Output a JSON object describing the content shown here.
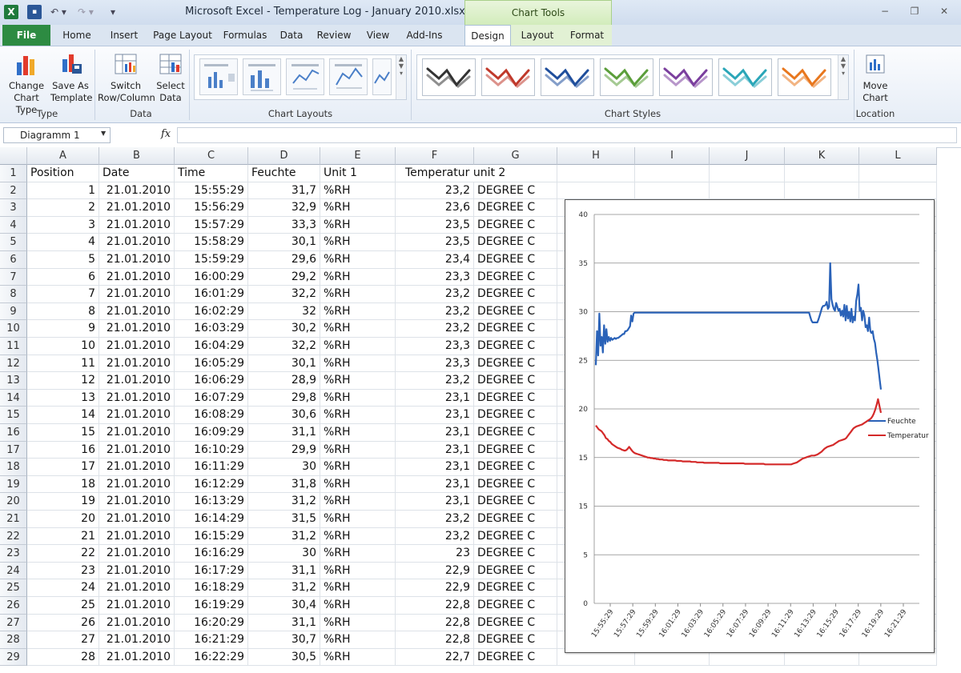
{
  "window": {
    "title": "Microsoft Excel - Temperature Log - January 2010.xlsx",
    "chart_tools_label": "Chart Tools",
    "controls": {
      "minimize": "−",
      "restore": "❐",
      "close": "✕"
    }
  },
  "quick_access": {
    "logo": "X",
    "save": "▪",
    "undo": "↶ ▾",
    "redo": "↷ ▾",
    "customize": "▾"
  },
  "tabs": [
    "File",
    "Home",
    "Insert",
    "Page Layout",
    "Formulas",
    "Data",
    "Review",
    "View",
    "Add-Ins",
    "Design",
    "Layout",
    "Format"
  ],
  "active_tab": "Design",
  "ribbon": {
    "type_group": {
      "label": "Type",
      "change_chart_type": [
        "Change",
        "Chart Type"
      ],
      "save_as_template": [
        "Save As",
        "Template"
      ]
    },
    "data_group": {
      "label": "Data",
      "switch_row_column": [
        "Switch",
        "Row/Column"
      ],
      "select_data": [
        "Select",
        "Data"
      ]
    },
    "chart_layouts_label": "Chart Layouts",
    "chart_styles_label": "Chart Styles",
    "style_colors": [
      "#333333",
      "#c0392b",
      "#1f4e9c",
      "#5b9e3a",
      "#7b3f9e",
      "#2aa6b8",
      "#e8771e"
    ],
    "location_group": {
      "label": "Location",
      "move_chart": [
        "Move",
        "Chart"
      ]
    }
  },
  "name_box": "Diagramm 1",
  "fx_label": "fx",
  "columns": [
    "A",
    "B",
    "C",
    "D",
    "E",
    "F",
    "G",
    "H",
    "I",
    "J",
    "K",
    "L"
  ],
  "header_row": [
    "Position",
    "Date",
    "Time",
    "Feuchte",
    "Unit 1",
    "Temperatur unit 2",
    ""
  ],
  "rows": [
    [
      "1",
      "21.01.2010",
      "15:55:29",
      "31,7",
      "%RH",
      "23,2",
      "DEGREE C"
    ],
    [
      "2",
      "21.01.2010",
      "15:56:29",
      "32,9",
      "%RH",
      "23,6",
      "DEGREE C"
    ],
    [
      "3",
      "21.01.2010",
      "15:57:29",
      "33,3",
      "%RH",
      "23,5",
      "DEGREE C"
    ],
    [
      "4",
      "21.01.2010",
      "15:58:29",
      "30,1",
      "%RH",
      "23,5",
      "DEGREE C"
    ],
    [
      "5",
      "21.01.2010",
      "15:59:29",
      "29,6",
      "%RH",
      "23,4",
      "DEGREE C"
    ],
    [
      "6",
      "21.01.2010",
      "16:00:29",
      "29,2",
      "%RH",
      "23,3",
      "DEGREE C"
    ],
    [
      "7",
      "21.01.2010",
      "16:01:29",
      "32,2",
      "%RH",
      "23,2",
      "DEGREE C"
    ],
    [
      "8",
      "21.01.2010",
      "16:02:29",
      "32",
      "%RH",
      "23,2",
      "DEGREE C"
    ],
    [
      "9",
      "21.01.2010",
      "16:03:29",
      "30,2",
      "%RH",
      "23,2",
      "DEGREE C"
    ],
    [
      "10",
      "21.01.2010",
      "16:04:29",
      "32,2",
      "%RH",
      "23,3",
      "DEGREE C"
    ],
    [
      "11",
      "21.01.2010",
      "16:05:29",
      "30,1",
      "%RH",
      "23,3",
      "DEGREE C"
    ],
    [
      "12",
      "21.01.2010",
      "16:06:29",
      "28,9",
      "%RH",
      "23,2",
      "DEGREE C"
    ],
    [
      "13",
      "21.01.2010",
      "16:07:29",
      "29,8",
      "%RH",
      "23,1",
      "DEGREE C"
    ],
    [
      "14",
      "21.01.2010",
      "16:08:29",
      "30,6",
      "%RH",
      "23,1",
      "DEGREE C"
    ],
    [
      "15",
      "21.01.2010",
      "16:09:29",
      "31,1",
      "%RH",
      "23,1",
      "DEGREE C"
    ],
    [
      "16",
      "21.01.2010",
      "16:10:29",
      "29,9",
      "%RH",
      "23,1",
      "DEGREE C"
    ],
    [
      "17",
      "21.01.2010",
      "16:11:29",
      "30",
      "%RH",
      "23,1",
      "DEGREE C"
    ],
    [
      "18",
      "21.01.2010",
      "16:12:29",
      "31,8",
      "%RH",
      "23,1",
      "DEGREE C"
    ],
    [
      "19",
      "21.01.2010",
      "16:13:29",
      "31,2",
      "%RH",
      "23,1",
      "DEGREE C"
    ],
    [
      "20",
      "21.01.2010",
      "16:14:29",
      "31,5",
      "%RH",
      "23,2",
      "DEGREE C"
    ],
    [
      "21",
      "21.01.2010",
      "16:15:29",
      "31,2",
      "%RH",
      "23,2",
      "DEGREE C"
    ],
    [
      "22",
      "21.01.2010",
      "16:16:29",
      "30",
      "%RH",
      "23",
      "DEGREE C"
    ],
    [
      "23",
      "21.01.2010",
      "16:17:29",
      "31,1",
      "%RH",
      "22,9",
      "DEGREE C"
    ],
    [
      "24",
      "21.01.2010",
      "16:18:29",
      "31,2",
      "%RH",
      "22,9",
      "DEGREE C"
    ],
    [
      "25",
      "21.01.2010",
      "16:19:29",
      "30,4",
      "%RH",
      "22,8",
      "DEGREE C"
    ],
    [
      "26",
      "21.01.2010",
      "16:20:29",
      "31,1",
      "%RH",
      "22,8",
      "DEGREE C"
    ],
    [
      "27",
      "21.01.2010",
      "16:21:29",
      "30,7",
      "%RH",
      "22,8",
      "DEGREE C"
    ],
    [
      "28",
      "21.01.2010",
      "16:22:29",
      "30,5",
      "%RH",
      "22,7",
      "DEGREE C"
    ]
  ],
  "chart_data": {
    "type": "line",
    "title": "",
    "xlabel": "",
    "ylabel": "",
    "ylim": [
      0,
      40
    ],
    "yticks": [
      "0",
      "5",
      "15",
      "15",
      "20",
      "25",
      "30",
      "35",
      "40"
    ],
    "categories": [
      "15:55:29",
      "15:57:29",
      "15:59:29",
      "16:01:29",
      "16:03:29",
      "16:05:29",
      "16:07:29",
      "16:09:29",
      "16:11:29",
      "16:13:29",
      "16:15:29",
      "16:17:29",
      "16:19:29",
      "16:21:29"
    ],
    "grid": true,
    "legend": "right",
    "series": [
      {
        "name": "Feuchte",
        "color": "#2a62b8",
        "values": [
          24.5,
          28.0,
          25.5,
          29.8,
          26.5,
          27.4,
          25.8,
          28.6,
          26.7,
          28.2,
          26.9,
          27.4,
          27.0,
          27.3,
          27.1,
          27.2,
          27.3,
          27.2,
          27.3,
          27.3,
          27.4,
          27.5,
          27.6,
          27.7,
          27.7,
          28.0,
          28.0,
          28.1,
          28.3,
          28.5,
          29.6,
          29.0,
          29.8,
          29.9,
          29.9,
          29.9,
          29.9,
          29.9,
          29.9,
          29.9,
          29.9,
          29.9,
          29.9,
          29.9,
          29.9,
          29.9,
          29.9,
          29.9,
          29.9,
          29.9,
          29.9,
          29.9,
          29.9,
          29.9,
          29.9,
          29.9,
          29.9,
          29.9,
          29.9,
          29.9,
          29.9,
          29.9,
          29.9,
          29.9,
          29.9,
          29.9,
          29.9,
          29.9,
          29.9,
          29.9,
          29.9,
          29.9,
          29.9,
          29.9,
          29.9,
          29.9,
          29.9,
          29.9,
          29.9,
          29.9,
          29.9,
          29.9,
          29.9,
          29.9,
          29.9,
          29.9,
          29.9,
          29.9,
          29.9,
          29.9,
          29.9,
          29.9,
          29.9,
          29.9,
          29.9,
          29.9,
          29.9,
          29.9,
          29.9,
          29.9,
          29.9,
          29.9,
          29.9,
          29.9,
          29.9,
          29.9,
          29.9,
          29.9,
          29.9,
          29.9,
          29.9,
          29.9,
          29.9,
          29.9,
          29.9,
          29.9,
          29.9,
          29.9,
          29.9,
          29.9,
          29.9,
          29.9,
          29.9,
          29.9,
          29.9,
          29.9,
          29.9,
          29.9,
          29.9,
          29.9,
          29.9,
          29.9,
          29.9,
          29.9,
          29.9,
          29.9,
          29.9,
          29.9,
          29.9,
          29.9,
          29.9,
          29.9,
          29.9,
          29.9,
          29.9,
          29.9,
          29.9,
          29.9,
          29.9,
          29.9,
          29.9,
          29.9,
          29.9,
          29.9,
          29.9,
          29.9,
          29.9,
          29.9,
          29.9,
          29.9,
          29.9,
          29.9,
          29.9,
          29.9,
          29.9,
          29.9,
          29.9,
          29.9,
          29.9,
          29.9,
          29.9,
          29.9,
          29.9,
          29.9,
          29.9,
          29.9,
          29.9,
          29.9,
          29.9,
          29.9,
          29.9,
          29.9,
          29.5,
          29.1,
          28.9,
          28.9,
          28.9,
          28.9,
          28.9,
          29.2,
          29.6,
          30.0,
          30.4,
          30.6,
          30.6,
          30.7,
          31.0,
          30.3,
          30.5,
          35.0,
          31.3,
          30.7,
          30.3,
          30.1,
          30.9,
          30.5,
          30.1,
          30.3,
          29.6,
          30.1,
          29.5,
          30.7,
          29.1,
          30.6,
          29.3,
          30.0,
          29.0,
          30.3,
          28.9,
          29.5,
          29.1,
          31.1,
          31.8,
          32.8,
          30.1,
          30.4,
          29.1,
          30.1,
          29.6,
          28.4,
          28.6,
          28.0,
          29.4,
          28.0,
          27.8,
          28.0,
          27.2,
          26.8,
          25.8,
          25.0,
          24.0,
          23.0,
          22.0
        ]
      },
      {
        "name": "Temperatur",
        "color": "#d42a2a",
        "values": [
          18.3,
          18.1,
          17.9,
          17.8,
          17.7,
          17.5,
          17.3,
          17.0,
          16.9,
          16.7,
          16.6,
          16.4,
          16.3,
          16.2,
          16.1,
          16.0,
          15.95,
          15.9,
          15.8,
          15.75,
          15.7,
          15.75,
          15.9,
          16.1,
          15.9,
          15.7,
          15.55,
          15.45,
          15.4,
          15.35,
          15.3,
          15.25,
          15.2,
          15.15,
          15.1,
          15.05,
          15.0,
          15.0,
          14.95,
          14.95,
          14.9,
          14.9,
          14.85,
          14.85,
          14.8,
          14.8,
          14.8,
          14.75,
          14.75,
          14.75,
          14.7,
          14.7,
          14.7,
          14.7,
          14.7,
          14.7,
          14.65,
          14.65,
          14.65,
          14.65,
          14.6,
          14.6,
          14.6,
          14.6,
          14.6,
          14.6,
          14.55,
          14.55,
          14.55,
          14.55,
          14.5,
          14.5,
          14.5,
          14.5,
          14.5,
          14.45,
          14.45,
          14.45,
          14.45,
          14.45,
          14.45,
          14.45,
          14.45,
          14.45,
          14.45,
          14.45,
          14.4,
          14.4,
          14.4,
          14.4,
          14.4,
          14.4,
          14.4,
          14.4,
          14.4,
          14.4,
          14.4,
          14.4,
          14.4,
          14.4,
          14.4,
          14.4,
          14.4,
          14.35,
          14.35,
          14.35,
          14.35,
          14.35,
          14.35,
          14.35,
          14.35,
          14.35,
          14.35,
          14.35,
          14.35,
          14.35,
          14.35,
          14.3,
          14.3,
          14.3,
          14.3,
          14.3,
          14.3,
          14.3,
          14.3,
          14.3,
          14.3,
          14.3,
          14.3,
          14.3,
          14.3,
          14.3,
          14.3,
          14.3,
          14.3,
          14.3,
          14.35,
          14.4,
          14.45,
          14.5,
          14.6,
          14.7,
          14.8,
          14.9,
          14.95,
          15.0,
          15.05,
          15.1,
          15.15,
          15.2,
          15.2,
          15.2,
          15.25,
          15.3,
          15.4,
          15.5,
          15.6,
          15.75,
          15.9,
          16.0,
          16.1,
          16.15,
          16.2,
          16.25,
          16.3,
          16.4,
          16.5,
          16.6,
          16.7,
          16.75,
          16.8,
          16.85,
          16.9,
          17.0,
          17.2,
          17.4,
          17.6,
          17.8,
          18.0,
          18.1,
          18.2,
          18.25,
          18.3,
          18.35,
          18.4,
          18.5,
          18.6,
          18.7,
          18.8,
          18.9,
          19.0,
          19.2,
          19.5,
          19.9,
          20.4,
          21.0,
          20.3,
          19.6
        ]
      }
    ]
  }
}
